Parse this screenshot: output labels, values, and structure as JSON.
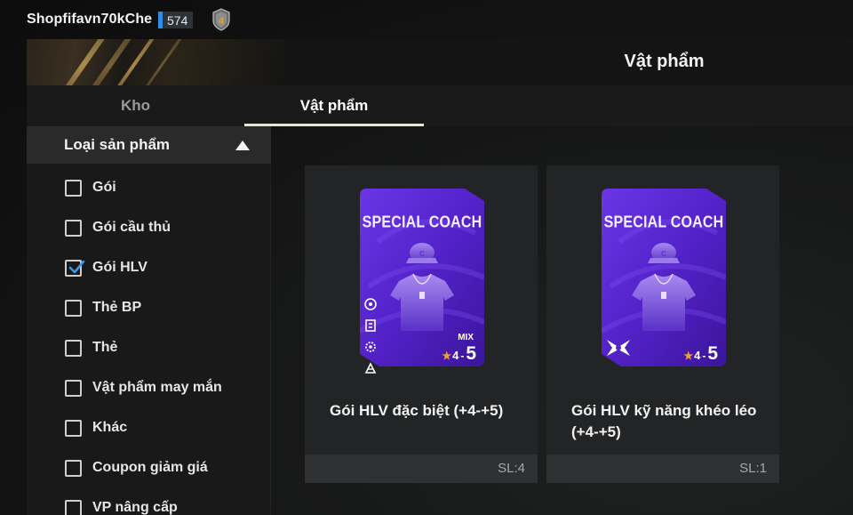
{
  "user": {
    "name": "Shopfifavn70kChe",
    "level": "574",
    "rank_badge": "rank-4-badge-icon"
  },
  "header": {
    "title": "Vật phẩm"
  },
  "tabs": [
    {
      "label": "Kho",
      "active": false
    },
    {
      "label": "Vật phẩm",
      "active": true
    }
  ],
  "sidebar": {
    "title": "Loại sản phẩm",
    "items": [
      {
        "label": "Gói",
        "checked": false
      },
      {
        "label": "Gói cầu thủ",
        "checked": false
      },
      {
        "label": "Gói HLV",
        "checked": true
      },
      {
        "label": "Thẻ BP",
        "checked": false
      },
      {
        "label": "Thẻ",
        "checked": false
      },
      {
        "label": "Vật phẩm may mắn",
        "checked": false
      },
      {
        "label": "Khác",
        "checked": false
      },
      {
        "label": "Coupon giảm giá",
        "checked": false
      },
      {
        "label": "VP nâng cấp",
        "checked": false
      }
    ]
  },
  "cards": [
    {
      "pack_title": "SPECIAL COACH",
      "tag": "MIX",
      "grade_min": "4",
      "grade_sep": "-",
      "grade_max": "5",
      "name": "Gói HLV đặc biệt (+4-+5)",
      "quantity": "SL:4"
    },
    {
      "pack_title": "SPECIAL COACH",
      "grade_min": "4",
      "grade_sep": "-",
      "grade_max": "5",
      "name": "Gói HLV kỹ năng khéo léo (+4-+5)",
      "quantity": "SL:1"
    }
  ],
  "colors": {
    "accent_blue": "#2f8de4",
    "pack_purple": "#5b2bd0",
    "star_gold": "#e8a33a",
    "tab_underline": "#ece6c8"
  }
}
